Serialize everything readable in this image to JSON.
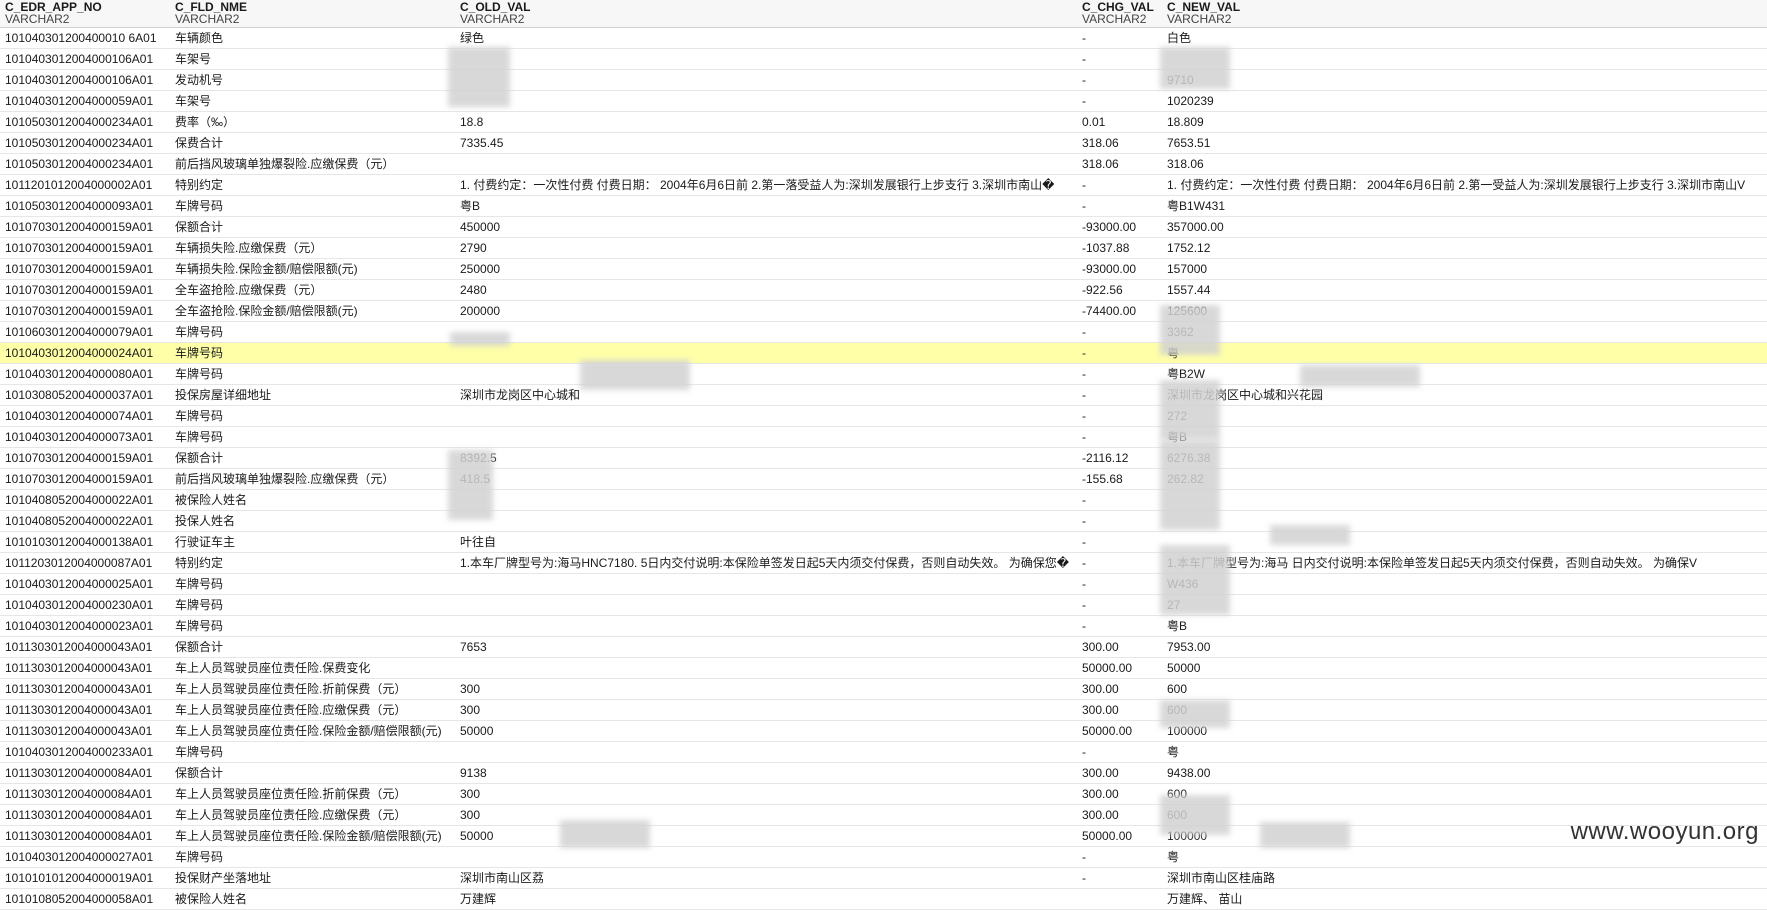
{
  "columns": [
    {
      "name": "C_EDR_APP_NO",
      "type": "VARCHAR2"
    },
    {
      "name": "C_FLD_NME",
      "type": "VARCHAR2"
    },
    {
      "name": "C_OLD_VAL",
      "type": "VARCHAR2"
    },
    {
      "name": "C_CHG_VAL",
      "type": "VARCHAR2"
    },
    {
      "name": "C_NEW_VAL",
      "type": "VARCHAR2"
    }
  ],
  "rows": [
    [
      "101040301200400010 6A01",
      "车辆颜色",
      "绿色",
      "-",
      "白色"
    ],
    [
      "1010403012004000106A01",
      "车架号",
      "",
      "-",
      ""
    ],
    [
      "1010403012004000106A01",
      "发动机号",
      "",
      "-",
      "9710"
    ],
    [
      "1010403012004000059A01",
      "车架号",
      "",
      "-",
      "1020239"
    ],
    [
      "1010503012004000234A01",
      "费率（‰）",
      "18.8",
      "0.01",
      "18.809"
    ],
    [
      "1010503012004000234A01",
      "保费合计",
      "7335.45",
      "318.06",
      "7653.51"
    ],
    [
      "1010503012004000234A01",
      "前后挡风玻璃单独爆裂险.应缴保费（元）",
      "",
      "318.06",
      "318.06"
    ],
    [
      "1011201012004000002A01",
      "特别约定",
      "1. 付费约定：一次性付费 付费日期： 2004年6月6日前 2.第一落受益人为:深圳发展银行上步支行 3.深圳市南山�",
      "-",
      "1. 付费约定：一次性付费 付费日期： 2004年6月6日前 2.第一受益人为:深圳发展银行上步支行 3.深圳市南山V"
    ],
    [
      "1010503012004000093A01",
      "车牌号码",
      "粤B",
      "-",
      "粤B1W431"
    ],
    [
      "1010703012004000159A01",
      "保额合计",
      "450000",
      "-93000.00",
      "357000.00"
    ],
    [
      "1010703012004000159A01",
      "车辆损失险.应缴保费（元）",
      "2790",
      "-1037.88",
      "1752.12"
    ],
    [
      "1010703012004000159A01",
      "车辆损失险.保险金额/赔偿限额(元)",
      "250000",
      "-93000.00",
      "157000"
    ],
    [
      "1010703012004000159A01",
      "全车盗抢险.应缴保费（元）",
      "2480",
      "-922.56",
      "1557.44"
    ],
    [
      "1010703012004000159A01",
      "全车盗抢险.保险金额/赔偿限额(元)",
      "200000",
      "-74400.00",
      "125600"
    ],
    [
      "1010603012004000079A01",
      "车牌号码",
      "",
      "-",
      "3362"
    ],
    [
      "1010403012004000024A01",
      "车牌号码",
      "",
      "-",
      "粤"
    ],
    [
      "1010403012004000080A01",
      "车牌号码",
      "",
      "-",
      "粤B2W"
    ],
    [
      "1010308052004000037A01",
      "投保房屋详细地址",
      "深圳市龙岗区中心城和",
      "-",
      "深圳市龙岗区中心城和兴花园"
    ],
    [
      "1010403012004000074A01",
      "车牌号码",
      "",
      "-",
      "272"
    ],
    [
      "1010403012004000073A01",
      "车牌号码",
      "",
      "-",
      "粤B"
    ],
    [
      "1010703012004000159A01",
      "保额合计",
      "8392.5",
      "-2116.12",
      "6276.38"
    ],
    [
      "1010703012004000159A01",
      "前后挡风玻璃单独爆裂险.应缴保费（元）",
      "418.5",
      "-155.68",
      "262.82"
    ],
    [
      "1010408052004000022A01",
      "被保险人姓名",
      "",
      "-",
      ""
    ],
    [
      "1010408052004000022A01",
      "投保人姓名",
      "",
      "-",
      ""
    ],
    [
      "1010103012004000138A01",
      "行驶证车主",
      "叶往自",
      "-",
      ""
    ],
    [
      "1011203012004000087A01",
      "特别约定",
      "1.本车厂牌型号为:海马HNC7180. 5日内交付说明:本保险单签发日起5天内须交付保费，否则自动失效。 为确保您�",
      "-",
      "1.本车厂牌型号为:海马 日内交付说明:本保险单签发日起5天内须交付保费，否则自动失效。 为确保V"
    ],
    [
      "1010403012004000025A01",
      "车牌号码",
      "",
      "-",
      "W436"
    ],
    [
      "1010403012004000230A01",
      "车牌号码",
      "",
      "-",
      "27"
    ],
    [
      "1010403012004000023A01",
      "车牌号码",
      "",
      "-",
      "粤B"
    ],
    [
      "1011303012004000043A01",
      "保额合计",
      "7653",
      "300.00",
      "7953.00"
    ],
    [
      "1011303012004000043A01",
      "车上人员驾驶员座位责任险.保费变化",
      "",
      "50000.00",
      "50000"
    ],
    [
      "1011303012004000043A01",
      "车上人员驾驶员座位责任险.折前保费（元）",
      "300",
      "300.00",
      "600"
    ],
    [
      "1011303012004000043A01",
      "车上人员驾驶员座位责任险.应缴保费（元）",
      "300",
      "300.00",
      "600"
    ],
    [
      "1011303012004000043A01",
      "车上人员驾驶员座位责任险.保险金额/赔偿限额(元)",
      "50000",
      "50000.00",
      "100000"
    ],
    [
      "1010403012004000233A01",
      "车牌号码",
      "",
      "-",
      "粤"
    ],
    [
      "1011303012004000084A01",
      "保额合计",
      "9138",
      "300.00",
      "9438.00"
    ],
    [
      "1011303012004000084A01",
      "车上人员驾驶员座位责任险.折前保费（元）",
      "300",
      "300.00",
      "600"
    ],
    [
      "1011303012004000084A01",
      "车上人员驾驶员座位责任险.应缴保费（元）",
      "300",
      "300.00",
      "600"
    ],
    [
      "1011303012004000084A01",
      "车上人员驾驶员座位责任险.保险金额/赔偿限额(元)",
      "50000",
      "50000.00",
      "100000"
    ],
    [
      "1010403012004000027A01",
      "车牌号码",
      "",
      "-",
      "粤"
    ],
    [
      "1010101012004000019A01",
      "投保财产坐落地址",
      "深圳市南山区荔",
      "-",
      "深圳市南山区桂庙路"
    ],
    [
      "1010108052004000058A01",
      "被保险人姓名",
      "万建辉",
      "",
      "万建辉、 苗山"
    ]
  ],
  "selected_row_index": 15,
  "watermark": "www.wooyun.org",
  "colors": {
    "selected_row": "#ffffa8",
    "border": "#e6e6e6",
    "header_bg": "#f7f7f7"
  }
}
